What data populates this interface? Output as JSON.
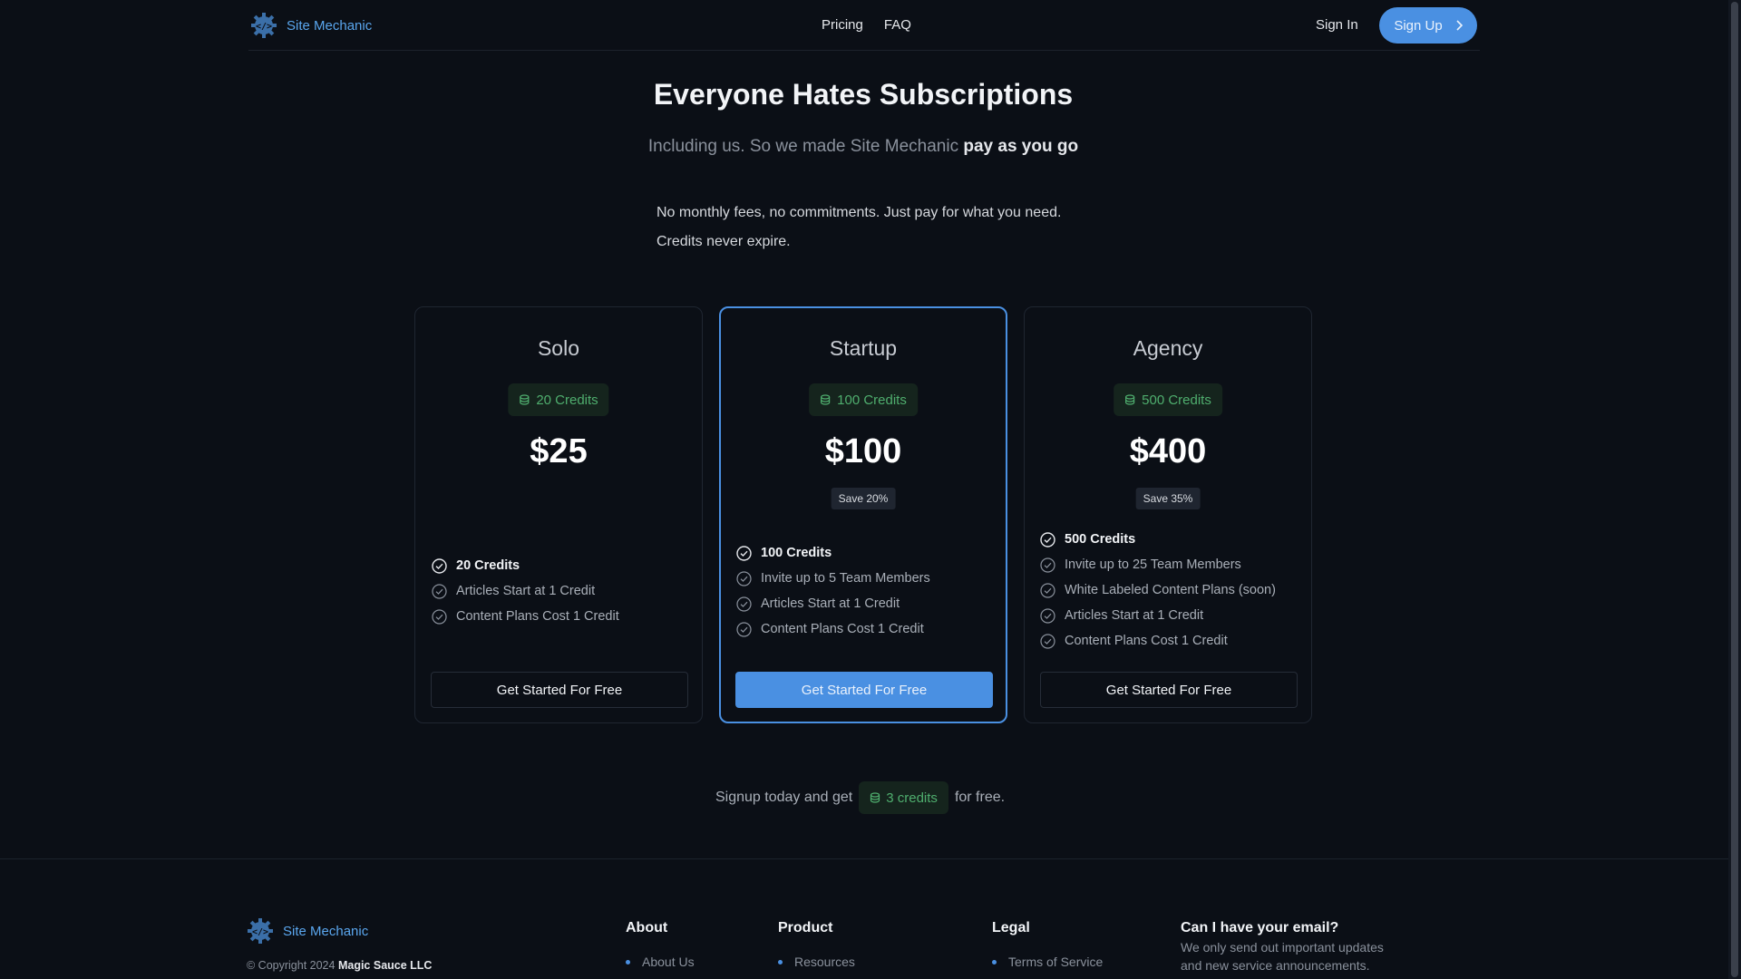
{
  "nav": {
    "brand": "Site Mechanic",
    "links": [
      "Pricing",
      "FAQ"
    ],
    "signin": "Sign In",
    "signup": "Sign Up"
  },
  "hero": {
    "title": "Everyone Hates Subscriptions",
    "subtitle_plain": "Including us. So we made Site Mechanic ",
    "subtitle_bold": "pay as you go",
    "desc_line1": "No monthly fees, no commitments. Just pay for what you need.",
    "desc_line2": "Credits never expire."
  },
  "plans": [
    {
      "name": "Solo",
      "credits": "20 Credits",
      "price": "$25",
      "save": "",
      "features": [
        "20 Credits",
        "Articles Start at 1 Credit",
        "Content Plans Cost 1 Credit"
      ],
      "cta": "Get Started For Free"
    },
    {
      "name": "Startup",
      "credits": "100 Credits",
      "price": "$100",
      "save": "Save 20%",
      "features": [
        "100 Credits",
        "Invite up to 5 Team Members",
        "Articles Start at 1 Credit",
        "Content Plans Cost 1 Credit"
      ],
      "cta": "Get Started For Free"
    },
    {
      "name": "Agency",
      "credits": "500 Credits",
      "price": "$400",
      "save": "Save 35%",
      "features": [
        "500 Credits",
        "Invite up to 25 Team Members",
        "White Labeled Content Plans (soon)",
        "Articles Start at 1 Credit",
        "Content Plans Cost 1 Credit"
      ],
      "cta": "Get Started For Free"
    }
  ],
  "promo": {
    "before": "Signup today and get",
    "credits": "3 credits",
    "after": "for free."
  },
  "footer": {
    "brand": "Site Mechanic",
    "copyright": "© Copyright 2024",
    "company": "Magic Sauce LLC",
    "about": {
      "title": "About",
      "items": [
        "About Us"
      ]
    },
    "product": {
      "title": "Product",
      "items": [
        "Resources"
      ]
    },
    "legal": {
      "title": "Legal",
      "items": [
        "Terms of Service"
      ]
    },
    "email": {
      "title": "Can I have your email?",
      "text": "We only send out important updates and new service announcements."
    }
  },
  "colors": {
    "background": "#0b0f16",
    "accent": "#4a90e2",
    "credit_green": "#4fae6e"
  },
  "icons": {
    "logo": "code-gear-icon",
    "check": "check-circle-icon",
    "coins": "coins-icon",
    "chevron": "chevron-right-icon"
  }
}
